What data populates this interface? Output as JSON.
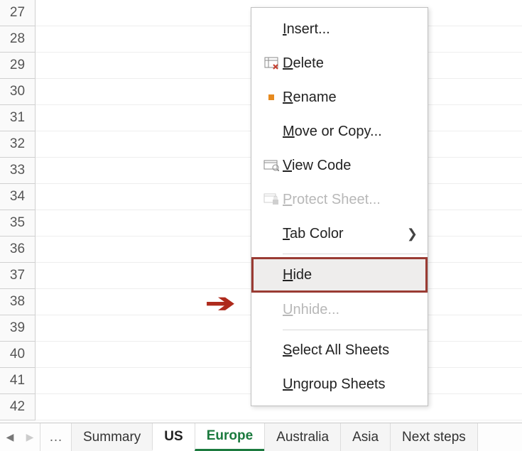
{
  "rows": [
    "27",
    "28",
    "29",
    "30",
    "31",
    "32",
    "33",
    "34",
    "35",
    "36",
    "37",
    "38",
    "39",
    "40",
    "41",
    "42"
  ],
  "tabs": {
    "ellipsis": "…",
    "items": [
      {
        "label": "Summary"
      },
      {
        "label": "US"
      },
      {
        "label": "Europe"
      },
      {
        "label": "Australia"
      },
      {
        "label": "Asia"
      },
      {
        "label": "Next steps"
      }
    ]
  },
  "menu": {
    "insert": {
      "pre": "",
      "u": "I",
      "post": "nsert..."
    },
    "delete": {
      "pre": "",
      "u": "D",
      "post": "elete"
    },
    "rename": {
      "pre": "",
      "u": "R",
      "post": "ename"
    },
    "move": {
      "pre": "",
      "u": "M",
      "post": "ove or Copy..."
    },
    "viewcode": {
      "pre": "",
      "u": "V",
      "post": "iew Code"
    },
    "protect": {
      "pre": "",
      "u": "P",
      "post": "rotect Sheet..."
    },
    "tabcolor": {
      "pre": "",
      "u": "T",
      "post": "ab Color"
    },
    "hide": {
      "pre": "",
      "u": "H",
      "post": "ide"
    },
    "unhide": {
      "pre": "",
      "u": "U",
      "post": "nhide..."
    },
    "selectall": {
      "pre": "",
      "u": "S",
      "post": "elect All Sheets"
    },
    "ungroup": {
      "pre": "",
      "u": "U",
      "post": "ngroup Sheets"
    }
  }
}
